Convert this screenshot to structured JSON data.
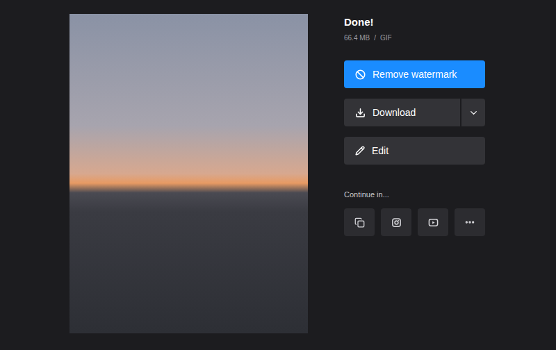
{
  "status": {
    "title": "Done!",
    "size": "66.4 MB",
    "separator": "/",
    "format": "GIF"
  },
  "preview": {
    "kind": "photo"
  },
  "actions": [
    {
      "label": "Remove watermark",
      "kind": "primary"
    },
    {
      "label": "Download",
      "kind": "split"
    },
    {
      "label": "Edit",
      "kind": "secondary"
    }
  ],
  "continue_in": {
    "label": "Continue in...",
    "targets": [
      {
        "kind": "merge"
      },
      {
        "kind": "instagram"
      },
      {
        "kind": "youtube"
      },
      {
        "kind": "more"
      }
    ]
  }
}
